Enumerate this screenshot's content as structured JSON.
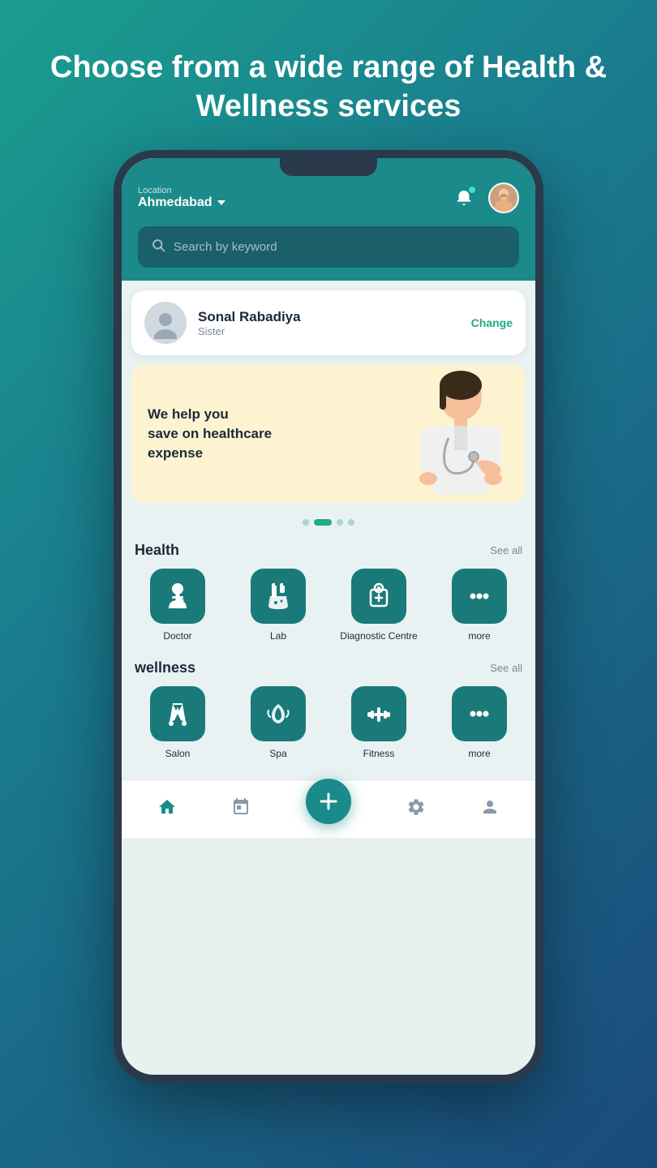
{
  "hero": {
    "title": "Choose from a wide range of Health & Wellness services"
  },
  "header": {
    "location_label": "Location",
    "location_value": "Ahmedabad",
    "bell_icon": "🔔",
    "avatar_alt": "User Avatar"
  },
  "search": {
    "placeholder": "Search by keyword"
  },
  "patient": {
    "name": "Sonal Rabadiya",
    "relation": "Sister",
    "change_label": "Change"
  },
  "banner": {
    "text_line1": "We help you",
    "text_line2": "save on healthcare",
    "text_line3": "expense",
    "dots": [
      {
        "active": false
      },
      {
        "active": true
      },
      {
        "active": false
      },
      {
        "active": false
      }
    ]
  },
  "health_section": {
    "title": "Health",
    "see_all": "See all",
    "services": [
      {
        "label": "Doctor",
        "icon": "🩺"
      },
      {
        "label": "Lab",
        "icon": "🧪"
      },
      {
        "label": "Diagnostic Centre",
        "icon": "🏥"
      },
      {
        "label": "more",
        "icon": "···"
      }
    ]
  },
  "wellness_section": {
    "title": "wellness",
    "see_all": "See all",
    "services": [
      {
        "label": "Salon",
        "icon": "✂️"
      },
      {
        "label": "Spa",
        "icon": "💆"
      },
      {
        "label": "Fitness",
        "icon": "🏋️"
      },
      {
        "label": "more",
        "icon": "···"
      }
    ]
  },
  "bottom_nav": {
    "items": [
      {
        "label": "Home",
        "icon": "⌂",
        "active": true
      },
      {
        "label": "Appointments",
        "icon": "📅"
      },
      {
        "label": "Add",
        "icon": "+"
      },
      {
        "label": "Settings",
        "icon": "⚙️"
      },
      {
        "label": "Profile",
        "icon": "👤"
      }
    ]
  }
}
